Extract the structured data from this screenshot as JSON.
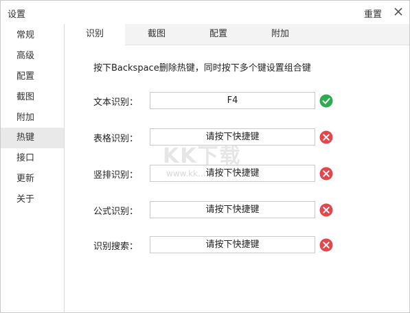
{
  "window": {
    "title": "设置",
    "reset_label": "重置"
  },
  "sidebar": {
    "items": [
      {
        "label": "常规"
      },
      {
        "label": "高级"
      },
      {
        "label": "配置"
      },
      {
        "label": "截图"
      },
      {
        "label": "附加"
      },
      {
        "label": "热键",
        "active": true
      },
      {
        "label": "接口"
      },
      {
        "label": "更新"
      },
      {
        "label": "关于"
      }
    ]
  },
  "tabs": [
    {
      "label": "识别",
      "active": true
    },
    {
      "label": "截图"
    },
    {
      "label": "配置"
    },
    {
      "label": "附加"
    }
  ],
  "hint": "按下Backspace删除热键，同时按下多个键设置组合键",
  "hotkeys": [
    {
      "label": "文本识别：",
      "value": "F4",
      "status": "set"
    },
    {
      "label": "表格识别：",
      "value": "请按下快捷键",
      "status": "unset"
    },
    {
      "label": "竖排识别：",
      "value": "请按下快捷键",
      "status": "unset"
    },
    {
      "label": "公式识别：",
      "value": "请按下快捷键",
      "status": "unset"
    },
    {
      "label": "识别搜索：",
      "value": "请按下快捷键",
      "status": "unset"
    }
  ],
  "watermark": {
    "text": "KK下载",
    "url": "www.kk..."
  },
  "colors": {
    "ok": "#2eaa4f",
    "error": "#e2474c",
    "active_bg": "#e9e9e9"
  },
  "icons": {
    "close": "close-icon",
    "ok": "check-circle-icon",
    "error": "x-circle-icon"
  }
}
